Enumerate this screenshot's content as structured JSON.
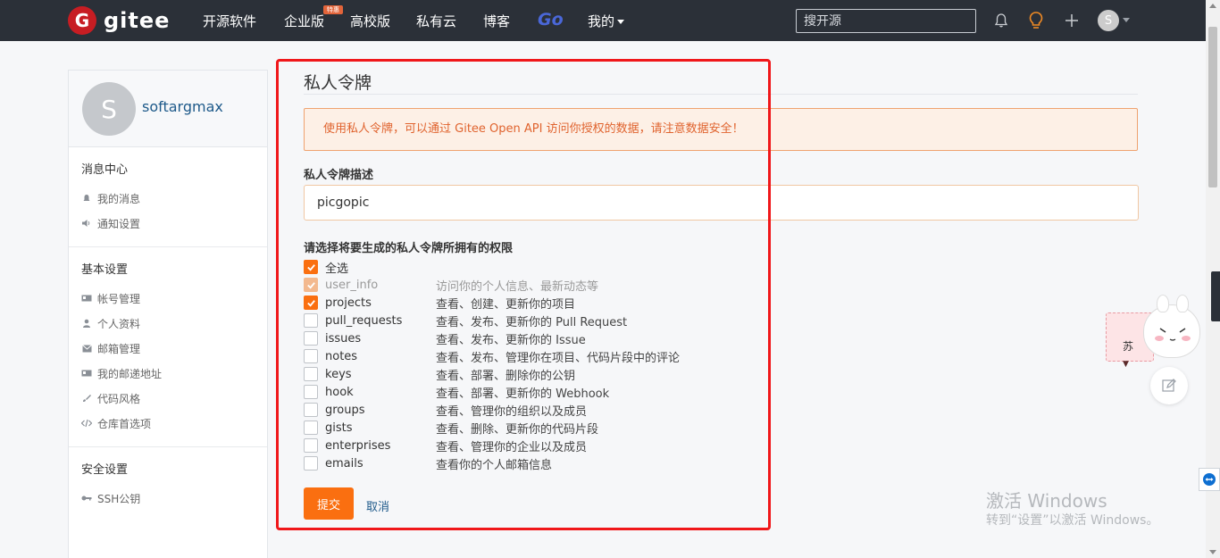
{
  "brand": {
    "logo_letter": "G",
    "name": "gitee"
  },
  "nav": {
    "items": [
      "开源软件",
      "企业版",
      "高校版",
      "私有云",
      "博客"
    ],
    "badge": "特惠",
    "go": "Go",
    "mine": "我的"
  },
  "search": {
    "placeholder": "搜开源"
  },
  "user": {
    "avatar_letter": "S",
    "name": "softargmax"
  },
  "sidebar": {
    "sections": [
      {
        "title": "消息中心",
        "items": [
          "我的消息",
          "通知设置"
        ]
      },
      {
        "title": "基本设置",
        "items": [
          "帐号管理",
          "个人资料",
          "邮箱管理",
          "我的邮递地址",
          "代码风格",
          "仓库首选项"
        ]
      },
      {
        "title": "安全设置",
        "items": [
          "SSH公钥"
        ]
      }
    ]
  },
  "form": {
    "title": "私人令牌",
    "alert": "使用私人令牌，可以通过 Gitee Open API 访问你授权的数据，请注意数据安全！",
    "desc_label": "私人令牌描述",
    "desc_value": "picgopic",
    "perm_label": "请选择将要生成的私人令牌所拥有的权限",
    "select_all": "全选",
    "permissions": [
      {
        "name": "user_info",
        "desc": "访问你的个人信息、最新动态等"
      },
      {
        "name": "projects",
        "desc": "查看、创建、更新你的项目"
      },
      {
        "name": "pull_requests",
        "desc": "查看、发布、更新你的 Pull Request"
      },
      {
        "name": "issues",
        "desc": "查看、发布、更新你的 Issue"
      },
      {
        "name": "notes",
        "desc": "查看、发布、管理你在项目、代码片段中的评论"
      },
      {
        "name": "keys",
        "desc": "查看、部署、删除你的公钥"
      },
      {
        "name": "hook",
        "desc": "查看、部署、更新你的 Webhook"
      },
      {
        "name": "groups",
        "desc": "查看、管理你的组织以及成员"
      },
      {
        "name": "gists",
        "desc": "查看、删除、更新你的代码片段"
      },
      {
        "name": "enterprises",
        "desc": "查看、管理你的企业以及成员"
      },
      {
        "name": "emails",
        "desc": "查看你的个人邮箱信息"
      }
    ],
    "submit": "提交",
    "cancel": "取消"
  },
  "sticker": {
    "text": "苏"
  },
  "watermark": {
    "line1": "激活 Windows",
    "line2": "转到“设置”以激活 Windows。"
  },
  "colors": {
    "accent": "#fa6f10",
    "topbar": "#2b3038",
    "highlight": "#f0171a",
    "link": "#1e5a8a"
  }
}
